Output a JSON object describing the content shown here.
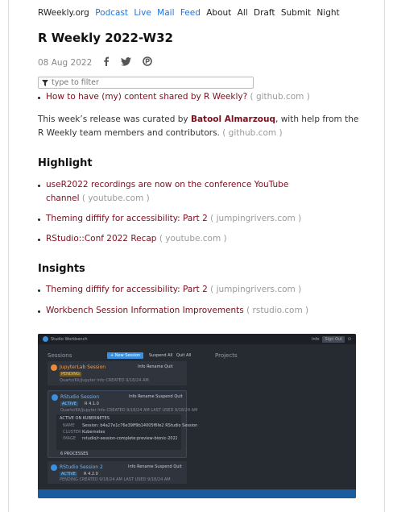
{
  "nav": {
    "items": [
      {
        "label": "RWeekly.org",
        "accent": false
      },
      {
        "label": "Podcast",
        "accent": true
      },
      {
        "label": "Live",
        "accent": true
      },
      {
        "label": "Mail",
        "accent": true
      },
      {
        "label": "Feed",
        "accent": true
      },
      {
        "label": "About",
        "accent": false
      },
      {
        "label": "All",
        "accent": false
      },
      {
        "label": "Draft",
        "accent": false
      },
      {
        "label": "Submit",
        "accent": false
      },
      {
        "label": "Night",
        "accent": false
      }
    ]
  },
  "post": {
    "title": "R Weekly 2022-W32",
    "date": "08 Aug 2022",
    "share_icons": [
      "facebook-icon",
      "twitter-icon",
      "pocket-icon"
    ],
    "filter_placeholder": "type to filter",
    "intro_link": {
      "text": "How to have (my) content shared by R Weekly?",
      "source": "( github.com )"
    },
    "curation": {
      "pre": "This week’s release was curated by ",
      "name": "Batool Almarzouq",
      "post": ", with help from the R Weekly team members and contributors. ",
      "source": "( github.com )"
    }
  },
  "sections": {
    "highlight": {
      "heading": "Highlight",
      "items": [
        {
          "line1": "useR2022 recordings are now on the conference YouTube",
          "line2": "channel",
          "source": "( youtube.com )"
        },
        {
          "text": "Theming diffify for accessibility: Part 2",
          "source": "( jumpingrivers.com )"
        },
        {
          "text": "RStudio::Conf 2022 Recap",
          "source": "( youtube.com )"
        }
      ]
    },
    "insights": {
      "heading": "Insights",
      "items": [
        {
          "text": "Theming diffify for accessibility: Part 2",
          "source": "( jumpingrivers.com )"
        },
        {
          "text": "Workbench Session Information Improvements",
          "source": "( rstudio.com )"
        }
      ]
    }
  },
  "embedded_screenshot": {
    "app_name": "Studio Workbench",
    "user": "Info",
    "sign_out": "Sign Out",
    "sessions_label": "Sessions",
    "projects_label": "Projects",
    "new_session": "+ New Session",
    "suspend_all": "Suspend All",
    "quit_all": "Quit All",
    "sessions": [
      {
        "name": "JupyterLab Session",
        "status": "PENDING",
        "meta": "Quartz/Kit/Jupyter Info   CREATED 9/18/24 AM"
      },
      {
        "name": "RStudio Session",
        "status": "ACTIVE",
        "version": "R 4.1.0",
        "meta": "Quartz/Kit/Jupyter Info   CREATED 9/18/24 AM   LAST USED 9/18/24 AM",
        "detail_header": "ACTIVE ON KUBERNETES",
        "details": [
          {
            "k": "NAME",
            "v": "Session: b4a27e1c76e39ff9b14005f6fe2   RStudio Session"
          },
          {
            "k": "CLUSTER",
            "v": "Kubernetes"
          },
          {
            "k": "IMAGE",
            "v": "rstudio/r-session-complete:preview-bionic-2022.07.0-preview"
          }
        ],
        "footer": "6 PROCESSES"
      },
      {
        "name": "RStudio Session 2",
        "status": "ACTIVE",
        "version": "R 4.2.0",
        "meta": "PENDING   CREATED 9/18/24 AM   LAST USED 9/18/24 AM"
      }
    ],
    "card_actions": [
      "Info",
      "Rename",
      "Suspend",
      "Quit"
    ]
  },
  "colors": {
    "accent_blue": "#1a73e8",
    "link": "#7a0f1e",
    "source": "#999999",
    "shot_bg": "#262a31",
    "shot_primary": "#3a8fe0"
  }
}
